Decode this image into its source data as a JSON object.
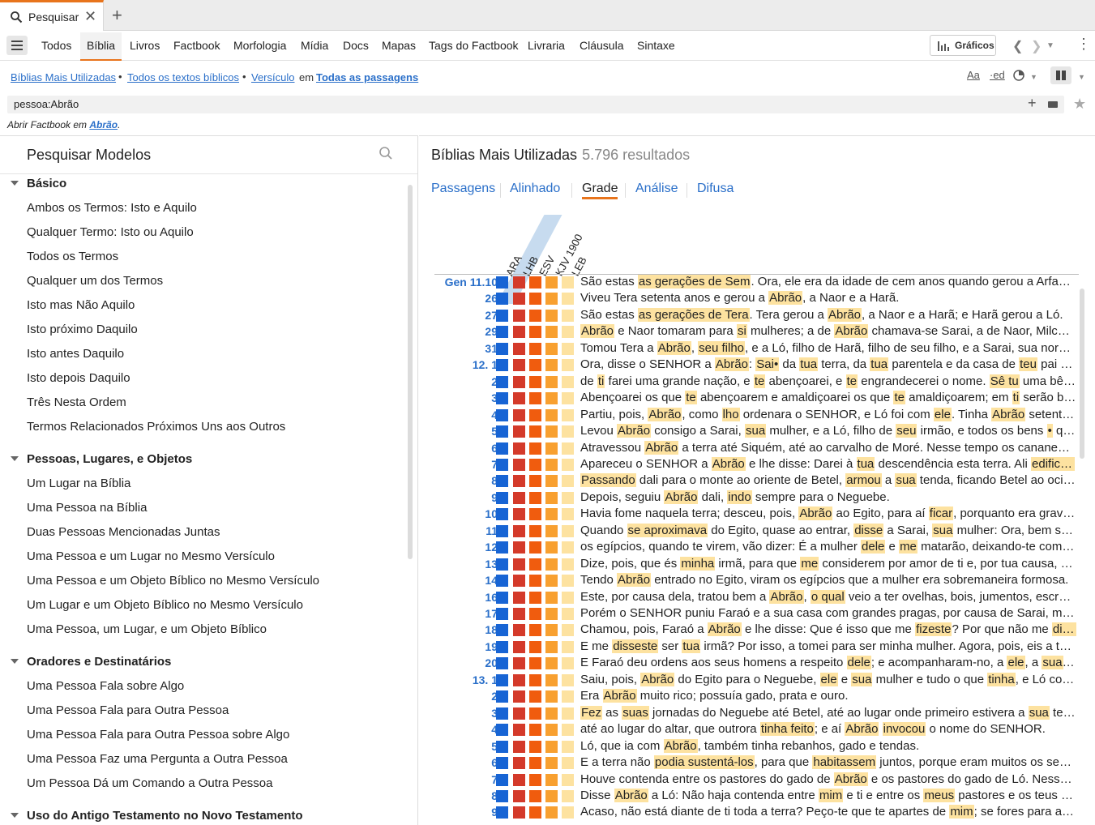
{
  "tab": {
    "label": "Pesquisar",
    "close": "✕",
    "new": "+"
  },
  "nav": [
    "Todos",
    "Bíblia",
    "Livros",
    "Factbook",
    "Morfologia",
    "Mídia",
    "Docs",
    "Mapas",
    "Tags do Factbook",
    "Livraria",
    "Cláusula",
    "Sintaxe"
  ],
  "nav_active": "Bíblia",
  "graficos_label": "Gráficos",
  "resource_line": {
    "link1": "Bíblias Mais Utilizadas",
    "link2": "Todos os textos bíblicos",
    "link3": "Versículo",
    "em": "em",
    "link4": "Todas as passagens",
    "right_icons": [
      "Aa",
      "·ed"
    ]
  },
  "search": {
    "query": "pessoa:Abrão"
  },
  "factbook_hint": {
    "prefix": "Abrir Factbook em",
    "link": "Abrão",
    "suffix": "."
  },
  "left_panel": {
    "title": "Pesquisar Modelos",
    "groups": [
      {
        "name": "Básico",
        "items": [
          "Ambos os Termos: Isto e Aquilo",
          "Qualquer Termo: Isto ou Aquilo",
          "Todos os Termos",
          "Qualquer um dos Termos",
          "Isto mas Não Aquilo",
          "Isto próximo Daquilo",
          "Isto antes Daquilo",
          "Isto depois Daquilo",
          "Três Nesta Ordem",
          "Termos Relacionados Próximos Uns aos Outros"
        ]
      },
      {
        "name": "Pessoas, Lugares, e Objetos",
        "items": [
          "Um Lugar na Bíblia",
          "Uma Pessoa na Bíblia",
          "Duas Pessoas Mencionadas Juntas",
          "Uma Pessoa e um Lugar no Mesmo Versículo",
          "Uma Pessoa e um Objeto Bíblico no Mesmo Versículo",
          "Um Lugar e um Objeto Bíblico no Mesmo Versículo",
          "Uma Pessoa, um Lugar, e um Objeto Bíblico"
        ]
      },
      {
        "name": "Oradores e Destinatários",
        "items": [
          "Uma Pessoa Fala sobre Algo",
          "Uma Pessoa Fala para Outra Pessoa",
          "Uma Pessoa Fala para Outra Pessoa sobre Algo",
          "Uma Pessoa Faz uma Pergunta a Outra Pessoa",
          "Um Pessoa Dá um Comando a Outra Pessoa"
        ]
      },
      {
        "name": "Uso do Antigo Testamento no Novo Testamento",
        "items": []
      }
    ]
  },
  "right_panel": {
    "title": "Bíblias Mais Utilizadas",
    "count": "5.796 resultados",
    "view_tabs": [
      "Passagens",
      "Alinhado",
      "Grade",
      "Análise",
      "Difusa"
    ],
    "active_view": "Grade",
    "columns": [
      "ARA",
      "LHB",
      "ESV",
      "KJV 1900",
      "LEB"
    ],
    "rows": [
      {
        "ref": "Gen 11.10",
        "text": "São estas <mark>as gerações de Sem</mark>. Ora, ele era da idade de cem anos quando gerou a Arfaxade, dois anos depois"
      },
      {
        "ref": "26",
        "text": "Viveu Tera setenta anos e gerou a <mark>Abrão</mark>, a Naor e a Harã."
      },
      {
        "ref": "27",
        "text": "São estas <mark>as gerações de Tera</mark>. Tera gerou a <mark>Abrão</mark>, a Naor e a Harã; e Harã gerou a Ló."
      },
      {
        "ref": "29",
        "text": "<mark>Abrão</mark> e Naor tomaram para <mark>si</mark> mulheres; a de <mark>Abrão</mark> chamava-se Sarai, a de Naor, Milca, filha de Harã"
      },
      {
        "ref": "31",
        "text": "Tomou Tera a <mark>Abrão</mark>, <mark>seu filho</mark>, e a Ló, filho de Harã, filho de seu filho, e a Sarai, sua nora, mulher de seu filho"
      },
      {
        "ref": "12. 1",
        "text": "Ora, disse o SENHOR a <mark>Abrão</mark>: <mark>Sai•</mark> da <mark>tua</mark> terra, da <mark>tua</mark> parentela e da casa de <mark>teu</mark> pai e vai para a terra"
      },
      {
        "ref": "2",
        "text": "de <mark>ti</mark> farei uma grande nação, e <mark>te</mark> abençoarei, e <mark>te</mark> engrandecerei o nome. <mark>Sê tu</mark> uma bênção!"
      },
      {
        "ref": "3",
        "text": "Abençoarei os que <mark>te</mark> abençoarem e amaldiçoarei os que <mark>te</mark> amaldiçoarem; em <mark>ti</mark> serão benditas todas as famílias"
      },
      {
        "ref": "4",
        "text": "Partiu, pois, <mark>Abrão</mark>, como <mark>lho</mark> ordenara o SENHOR, e Ló foi com <mark>ele</mark>. Tinha <mark>Abrão</mark> setenta e cinco anos"
      },
      {
        "ref": "5",
        "text": "Levou <mark>Abrão</mark> consigo a Sarai, <mark>sua</mark> mulher, e a Ló, filho de <mark>seu</mark> irmão, e todos os bens <mark>•</mark> que haviam adquirido"
      },
      {
        "ref": "6",
        "text": "Atravessou <mark>Abrão</mark> a terra até Siquém, até ao carvalho de Moré. Nesse tempo os cananeus habitavam essa terra"
      },
      {
        "ref": "7",
        "text": "Apareceu o SENHOR a <mark>Abrão</mark> e lhe disse: Darei à <mark>tua</mark> descendência esta terra. Ali <mark>edificou</mark> Abrão um altar"
      },
      {
        "ref": "8",
        "text": "<mark>Passando</mark> dali para o monte ao oriente de Betel, <mark>armou</mark> a <mark>sua</mark> tenda, ficando Betel ao ocidente e Ai ao oriente"
      },
      {
        "ref": "9",
        "text": "Depois, seguiu <mark>Abrão</mark> dali, <mark>indo</mark> sempre para o Neguebe."
      },
      {
        "ref": "10",
        "text": "Havia fome naquela terra; desceu, pois, <mark>Abrão</mark> ao Egito, para aí <mark>ficar</mark>, porquanto era grave a fome na terra"
      },
      {
        "ref": "11",
        "text": "Quando <mark>se aproximava</mark> do Egito, quase ao entrar, <mark>disse</mark> a Sarai, <mark>sua</mark> mulher: Ora, bem sei que és mulher"
      },
      {
        "ref": "12",
        "text": "os egípcios, quando te virem, vão dizer: É a mulher <mark>dele</mark> e <mark>me</mark> matarão, deixando-te com vida."
      },
      {
        "ref": "13",
        "text": "Dize, pois, que és <mark>minha</mark> irmã, para que <mark>me</mark> considerem por amor de ti e, por tua causa, me conservem a vida"
      },
      {
        "ref": "14",
        "text": "Tendo <mark>Abrão</mark> entrado no Egito, viram os egípcios que a mulher era sobremaneira formosa."
      },
      {
        "ref": "16",
        "text": "Este, por causa dela, tratou bem a <mark>Abrão</mark>, <mark>o qual</mark> veio a ter ovelhas, bois, jumentos, escravos e escravas"
      },
      {
        "ref": "17",
        "text": "Porém o SENHOR puniu Faraó e a sua casa com grandes pragas, por causa de Sarai, mulher de Abrão."
      },
      {
        "ref": "18",
        "text": "Chamou, pois, Faraó a <mark>Abrão</mark> e lhe disse: Que é isso que me <mark>fizeste</mark>? Por que não me <mark>disseste</mark> que era ela tua mulher?"
      },
      {
        "ref": "19",
        "text": "E me <mark>disseste</mark> ser <mark>tua</mark> irmã? Por isso, a tomei para ser minha mulher. Agora, pois, eis a tua mulher"
      },
      {
        "ref": "20",
        "text": "E Faraó deu ordens aos seus homens a respeito <mark>dele</mark>; e acompanharam-no, a <mark>ele</mark>, a <mark>sua</mark> mulher e tudo o que possuía."
      },
      {
        "ref": "13. 1",
        "text": "Saiu, pois, <mark>Abrão</mark> do Egito para o Neguebe, <mark>ele</mark> e <mark>sua</mark> mulher e tudo o que <mark>tinha</mark>, e Ló com ele."
      },
      {
        "ref": "2",
        "text": "Era <mark>Abrão</mark> muito rico; possuía gado, prata e ouro."
      },
      {
        "ref": "3",
        "text": "<mark>Fez</mark> as <mark>suas</mark> jornadas do Neguebe até Betel, até ao lugar onde primeiro estivera a <mark>sua</mark> tenda, entre Betel e Ai"
      },
      {
        "ref": "4",
        "text": "até ao lugar do altar, que outrora <mark>tinha feito</mark>; e aí <mark>Abrão</mark> <mark>invocou</mark> o nome do SENHOR."
      },
      {
        "ref": "5",
        "text": "Ló, que ia com <mark>Abrão</mark>, também tinha rebanhos, gado e tendas."
      },
      {
        "ref": "6",
        "text": "E a terra não <mark>podia sustentá-los</mark>, para que <mark>habitassem</mark> juntos, porque eram muitos os seus bens"
      },
      {
        "ref": "7",
        "text": "Houve contenda entre os pastores do gado de <mark>Abrão</mark> e os pastores do gado de Ló. Nesse tempo os cananeus"
      },
      {
        "ref": "8",
        "text": "Disse <mark>Abrão</mark> a Ló: Não haja contenda entre <mark>mim</mark> e ti e entre os <mark>meus</mark> pastores e os teus pastores"
      },
      {
        "ref": "9",
        "text": "Acaso, não está diante de ti toda a terra? Peço-te que te apartes de <mark>mim</mark>; se fores para a esquerda, irei para a direita"
      }
    ]
  }
}
